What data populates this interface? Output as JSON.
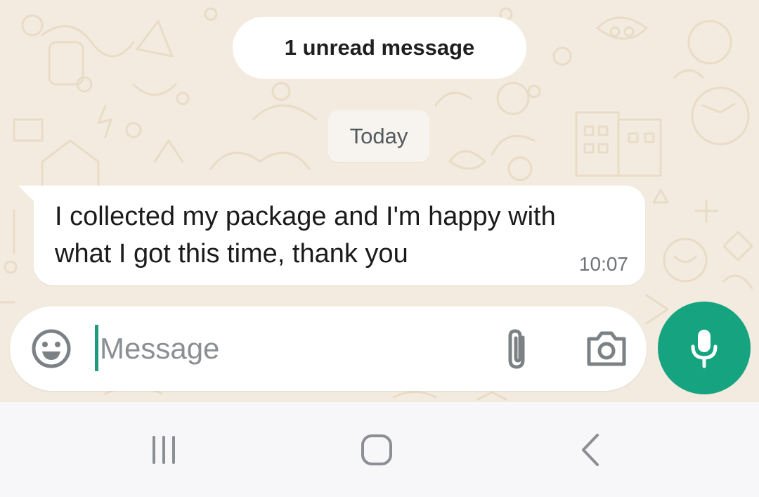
{
  "banner": {
    "unread_label": "1 unread message"
  },
  "date_divider": {
    "label": "Today"
  },
  "messages": [
    {
      "text": "I collected my package and I'm happy with what I got this time, thank you",
      "time": "10:07",
      "direction": "incoming"
    }
  ],
  "composer": {
    "placeholder": "Message",
    "value": "",
    "icons": [
      "emoji-icon",
      "attach-icon",
      "camera-icon"
    ]
  },
  "mic_button": {
    "icon": "microphone-icon",
    "color": "#15a47f"
  },
  "nav_bar": {
    "buttons": [
      "recents-icon",
      "home-icon",
      "back-icon"
    ]
  },
  "colors": {
    "accent": "#15a47f",
    "chat_background": "#f3ebe0",
    "bubble": "#ffffff"
  }
}
